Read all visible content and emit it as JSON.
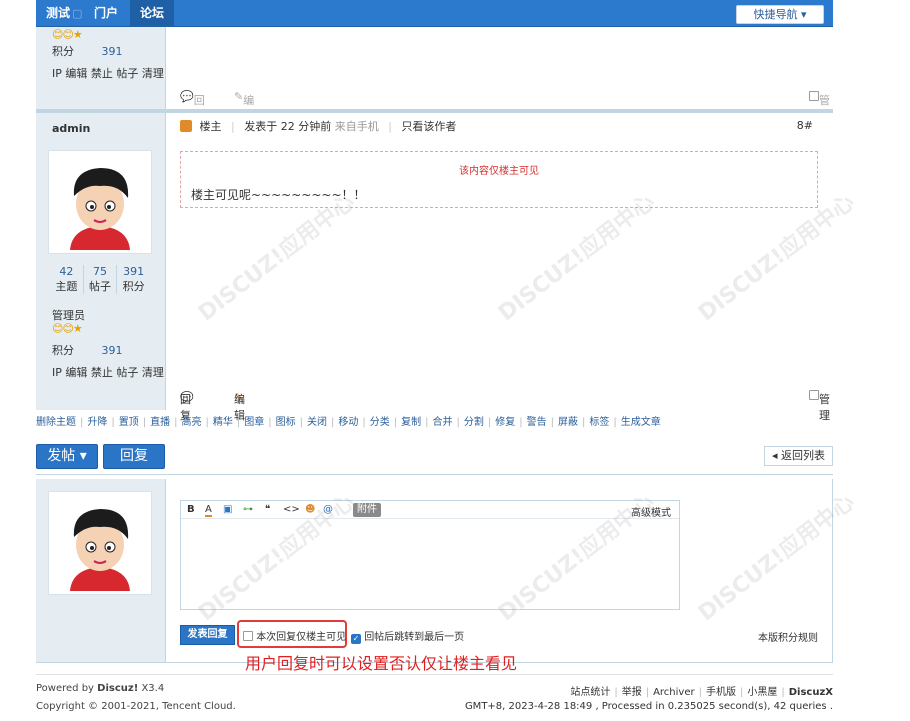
{
  "nav": {
    "items": [
      {
        "label": "测试"
      },
      {
        "label": "门户"
      },
      {
        "label": "论坛"
      }
    ],
    "quick_nav": "快捷导航 ▾"
  },
  "prev_post": {
    "score_label": "积分",
    "score_value": "391",
    "admin_links": "IP 编辑 禁止 帖子 清理",
    "reply": "回复",
    "edit": "编辑",
    "manage": "管理"
  },
  "post": {
    "author": "admin",
    "stats": [
      {
        "num": "42",
        "label": "主题"
      },
      {
        "num": "75",
        "label": "帖子"
      },
      {
        "num": "391",
        "label": "积分"
      }
    ],
    "group": "管理员",
    "score_label": "积分",
    "score_value": "391",
    "admin_links": "IP 编辑 禁止 帖子 清理",
    "owner_tag": "楼主",
    "posted": "发表于 22 分钟前",
    "from": "来自手机",
    "only_author": "只看该作者",
    "floor": "8#",
    "locked_tip": "该内容仅楼主可见",
    "content": "楼主可见呢~~~~~~~~~！！",
    "reply": "回复",
    "edit": "编辑",
    "manage": "管理"
  },
  "mod_links": [
    "删除主题",
    "升降",
    "置顶",
    "直播",
    "高亮",
    "精华",
    "图章",
    "图标",
    "关闭",
    "移动",
    "分类",
    "复制",
    "合并",
    "分割",
    "修复",
    "警告",
    "屏蔽",
    "标签",
    "生成文章"
  ],
  "actions": {
    "new_thread": "发帖 ▾",
    "reply": "回复",
    "back_list": "◂ 返回列表"
  },
  "editor": {
    "attach": "附件",
    "advanced": "高级模式",
    "submit": "发表回复",
    "opt_owner_only": "本次回复仅楼主可见",
    "opt_jump": "回帖后跳转到最后一页",
    "rule": "本版积分规则"
  },
  "annotation": "用户回复时可以设置否认仅让楼主看见",
  "footer": {
    "powered_prefix": "Powered by",
    "powered_brand": "Discuz!",
    "powered_ver": "X3.4",
    "copyright": "Copyright © 2001-2021, Tencent Cloud.",
    "links": [
      "站点统计",
      "举报",
      "Archiver",
      "手机版",
      "小黑屋"
    ],
    "brand": "DiscuzX",
    "gmt": "GMT+8, 2023-4-28 18:49 , Processed in 0.235025 second(s), 42 queries ."
  }
}
